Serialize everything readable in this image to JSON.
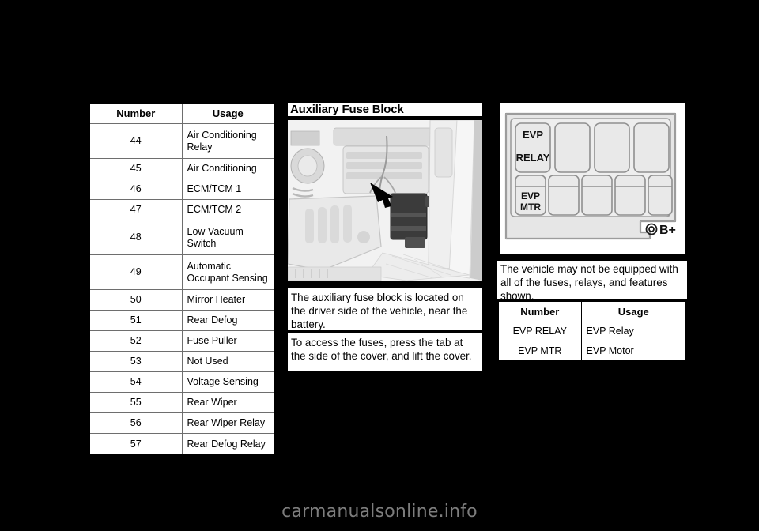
{
  "left_table": {
    "headers": [
      "Number",
      "Usage"
    ],
    "rows": [
      {
        "number": "44",
        "usage": "Air Conditioning Relay",
        "tall": true
      },
      {
        "number": "45",
        "usage": "Air Conditioning",
        "tall": false
      },
      {
        "number": "46",
        "usage": "ECM/TCM 1",
        "tall": false
      },
      {
        "number": "47",
        "usage": "ECM/TCM 2",
        "tall": false
      },
      {
        "number": "48",
        "usage": "Low Vacuum Switch",
        "tall": true
      },
      {
        "number": "49",
        "usage": "Automatic Occupant Sensing",
        "tall": true
      },
      {
        "number": "50",
        "usage": "Mirror Heater",
        "tall": false
      },
      {
        "number": "51",
        "usage": "Rear Defog",
        "tall": false
      },
      {
        "number": "52",
        "usage": "Fuse Puller",
        "tall": false
      },
      {
        "number": "53",
        "usage": "Not Used",
        "tall": false
      },
      {
        "number": "54",
        "usage": "Voltage Sensing",
        "tall": false
      },
      {
        "number": "55",
        "usage": "Rear Wiper",
        "tall": false
      },
      {
        "number": "56",
        "usage": "Rear Wiper Relay",
        "tall": false
      },
      {
        "number": "57",
        "usage": "Rear Defog Relay",
        "tall": false
      }
    ]
  },
  "middle": {
    "heading": "Auxiliary Fuse Block",
    "photo_caption": "engine-compartment-auxiliary-fuse-block-photo",
    "paragraph_1": "The auxiliary fuse block is located on the driver side of the vehicle, near the battery.",
    "paragraph_2": "To access the fuses, press the tab at the side of the cover, and lift the cover."
  },
  "right": {
    "diagram": {
      "slots_top": [
        "EVP RELAY",
        "",
        "",
        ""
      ],
      "slots_top_line1": [
        "EVP",
        "",
        "",
        ""
      ],
      "slots_top_line2": [
        "RELAY",
        "",
        "",
        ""
      ],
      "slots_bottom": [
        "EVP MTR",
        "",
        "",
        "",
        ""
      ],
      "slots_bottom_line1": [
        "EVP",
        "",
        "",
        "",
        ""
      ],
      "slots_bottom_line2": [
        "MTR",
        "",
        "",
        "",
        ""
      ],
      "terminal_label": "B+"
    },
    "note": "The vehicle may not be equipped with all of the fuses, relays, and features shown.",
    "table": {
      "headers": [
        "Number",
        "Usage"
      ],
      "rows": [
        {
          "number": "EVP RELAY",
          "usage": "EVP Relay"
        },
        {
          "number": "EVP MTR",
          "usage": "EVP Motor"
        }
      ]
    }
  },
  "watermark": "carmanualsonline.info",
  "colors": {
    "page_background": "#000000",
    "content_background": "#ffffff",
    "rule": "#6e6e6e",
    "text": "#000000",
    "watermark": "#7d7d7d",
    "diagram_fill": "#e3e3e3"
  }
}
